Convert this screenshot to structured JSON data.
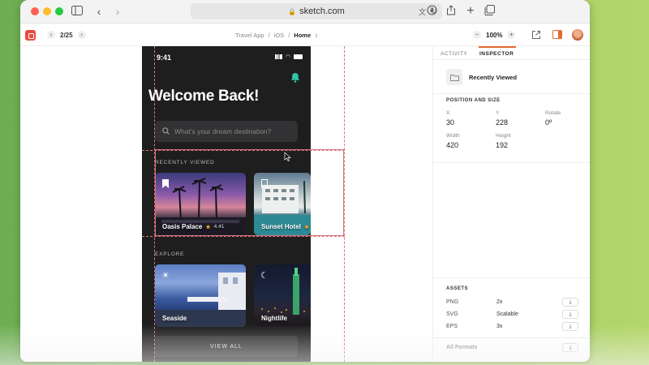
{
  "browser": {
    "url": "sketch.com",
    "icons": [
      "sidebar-icon",
      "back-icon",
      "forward-icon",
      "translate-icon",
      "reload-icon",
      "download-icon",
      "share-icon",
      "new-tab-icon",
      "tabs-icon"
    ]
  },
  "header": {
    "page_indicator": "2/25",
    "breadcrumb": [
      "Travel App",
      "iOS",
      "Home"
    ],
    "zoom": "100%",
    "zoom_minus": "−",
    "zoom_plus": "+"
  },
  "phone": {
    "time": "9:41",
    "title": "Welcome Back!",
    "search_placeholder": "What's your dream destination?",
    "recently_viewed_title": "RECENTLY VIEWED",
    "recent_cards": [
      {
        "name": "Oasis Palace",
        "rating": "4.41"
      },
      {
        "name": "Sunset Hotel",
        "rating": ""
      }
    ],
    "explore_title": "EXPLORE",
    "explore_cards": [
      {
        "name": "Seaside",
        "icon": "sun-icon"
      },
      {
        "name": "Nightlife",
        "icon": "moon-icon"
      }
    ],
    "view_all": "VIEW ALL"
  },
  "inspector": {
    "tabs": [
      "ACTIVITY",
      "INSPECTOR"
    ],
    "active_tab": "INSPECTOR",
    "layer_name": "Recently Viewed",
    "position_title": "POSITION AND SIZE",
    "x_label": "X",
    "x_value": "30",
    "y_label": "Y",
    "y_value": "228",
    "rotate_label": "Rotate",
    "rotate_value": "0º",
    "width_label": "Width",
    "width_value": "420",
    "height_label": "Height",
    "height_value": "192",
    "assets_title": "ASSETS",
    "assets": [
      {
        "format": "PNG",
        "scale": "2x"
      },
      {
        "format": "SVG",
        "scale": "Scalable"
      },
      {
        "format": "EPS",
        "scale": "3x"
      }
    ],
    "all_formats": "All Formats"
  },
  "colors": {
    "accent": "#e36a2f",
    "selection": "#d9737b",
    "bell": "#2ec4a5",
    "phone_bg": "#1e1e1f",
    "star": "#f4a52a"
  }
}
